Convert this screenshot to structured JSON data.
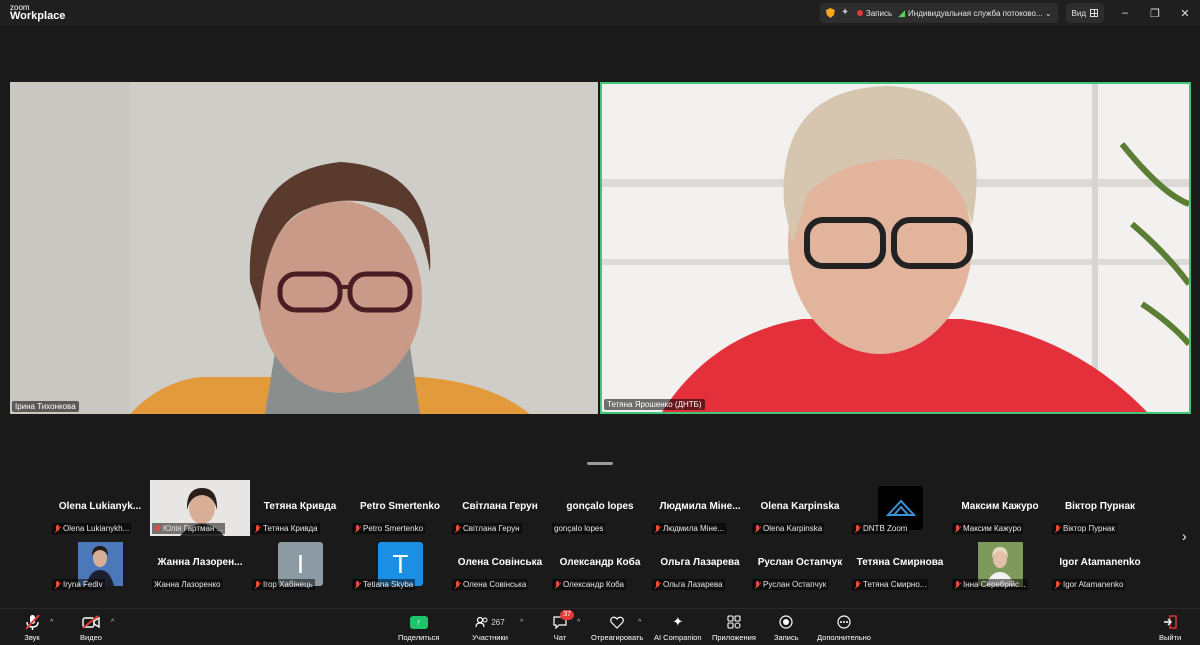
{
  "app": {
    "logo_top": "zoom",
    "logo_bottom": "Workplace"
  },
  "titlebar": {
    "record_label": "Запись",
    "stream_label": "Индивидуальная служба потоково...",
    "view_label": "Вид"
  },
  "main_videos": [
    {
      "name": "Ірина Тихонкова"
    },
    {
      "name": "Тетяна Ярошенко (ДНТБ)"
    }
  ],
  "gallery": {
    "row1": [
      {
        "big": "Olena  Lukianyk...",
        "small": "Olena Lukianykh..."
      },
      {
        "big": "",
        "small": "Юлія Гартман ..."
      },
      {
        "big": "Тетяна Кривда",
        "small": "Тетяна Кривда"
      },
      {
        "big": "Petro Smertenko",
        "small": "Petro Smertenko"
      },
      {
        "big": "Світлана Герун",
        "small": "Світлана Герун"
      },
      {
        "big": "gonçalo lopes",
        "small": "gonçalo lopes"
      },
      {
        "big": "Людмила  Міне...",
        "small": "Людмила Міне..."
      },
      {
        "big": "Olena Karpinska",
        "small": "Olena Karpinska"
      },
      {
        "big": "",
        "small": "DNTB Zoom"
      },
      {
        "big": "Максим Кажуро",
        "small": "Максим Кажуро"
      },
      {
        "big": "Віктор Пурнак",
        "small": "Віктор Пурнак"
      }
    ],
    "row2": [
      {
        "big": "",
        "small": "Iryna Fediv"
      },
      {
        "big": "Жанна  Лазорен...",
        "small": "Жанна Лазоренко"
      },
      {
        "big": "I",
        "small": "Ігор Хабінець"
      },
      {
        "big": "T",
        "small": "Tetiana Skyba"
      },
      {
        "big": "Олена Совінська",
        "small": "Олена Совінська"
      },
      {
        "big": "Олександр Коба",
        "small": "Олександр Коба"
      },
      {
        "big": "Ольга Лазарева",
        "small": "Ольга Лазарева"
      },
      {
        "big": "Руслан Остапчук",
        "small": "Руслан Остапчук"
      },
      {
        "big": "Тетяна Смирнова",
        "small": "Тетяна Смирно..."
      },
      {
        "big": "",
        "small": "Інна Серебрійс..."
      },
      {
        "big": "Igor Atamanenko",
        "small": "Igor Atamanenko"
      }
    ]
  },
  "toolbar": {
    "audio": "Звук",
    "video": "Видео",
    "share": "Поделиться",
    "participants": "Участники",
    "participants_count": "267",
    "chat": "Чат",
    "chat_badge": "37",
    "react": "Отреагировать",
    "ai": "AI Companion",
    "apps": "Приложения",
    "record": "Запись",
    "more": "Дополнительно",
    "leave": "Выйти"
  },
  "colors": {
    "active_speaker": "#43c478",
    "muted": "#e74c3c",
    "share": "#1ec46b",
    "avatar_grey": "#8b9aa3",
    "avatar_blue": "#1a8fe3"
  }
}
